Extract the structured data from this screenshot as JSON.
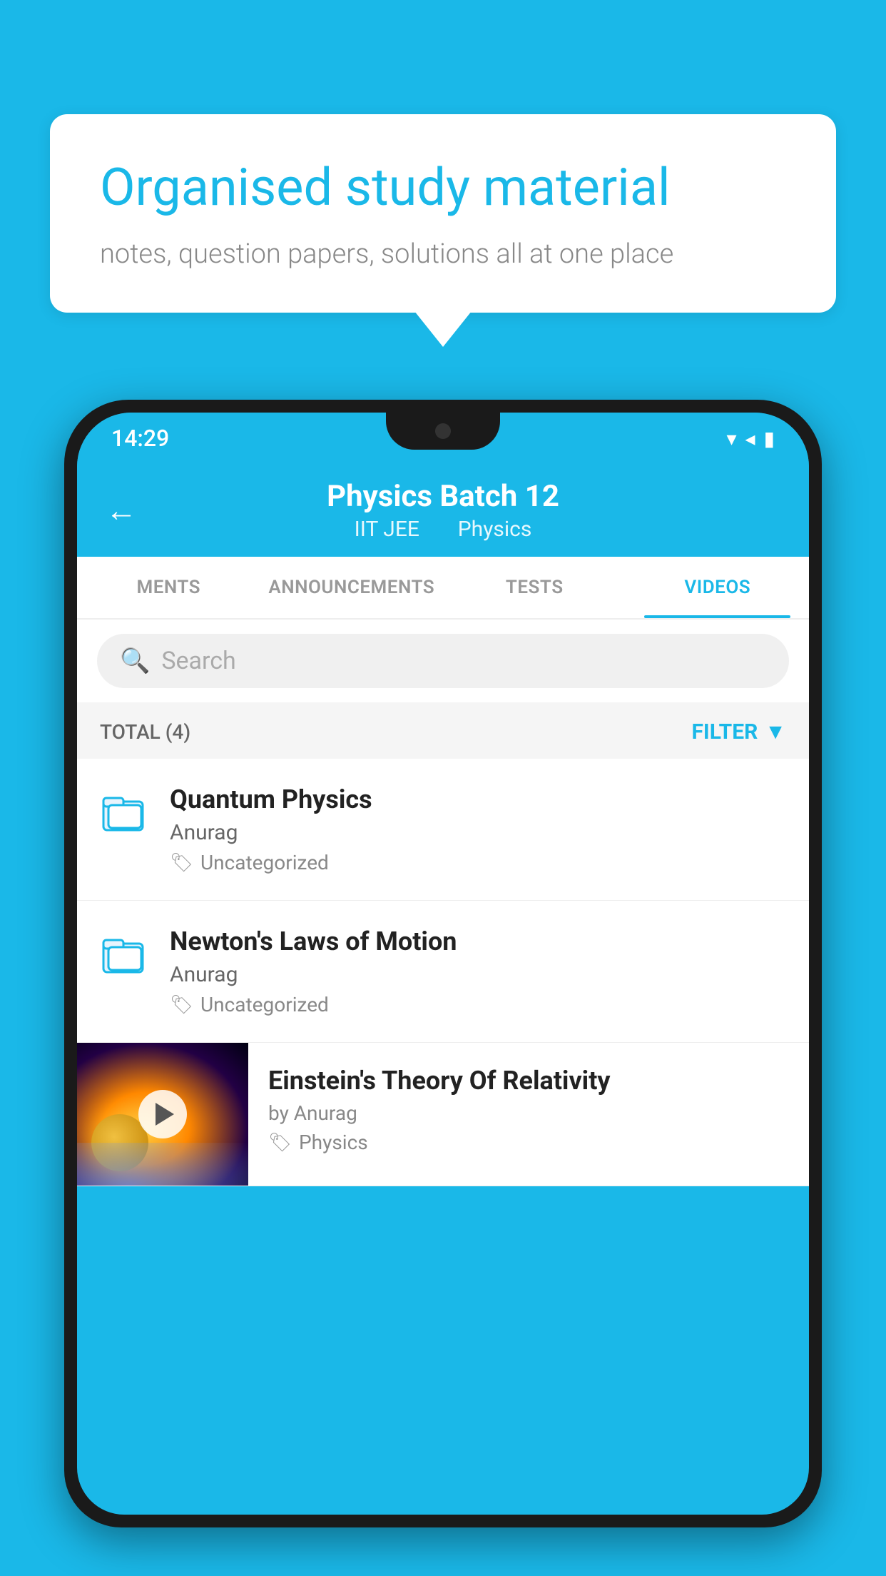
{
  "background": {
    "color": "#1ab8e8"
  },
  "speech_bubble": {
    "title": "Organised study material",
    "subtitle": "notes, question papers, solutions all at one place"
  },
  "status_bar": {
    "time": "14:29",
    "wifi": "▼",
    "signal": "▲",
    "battery": "▮"
  },
  "app_bar": {
    "back_label": "←",
    "title": "Physics Batch 12",
    "subtitle_board": "IIT JEE",
    "subtitle_subject": "Physics"
  },
  "tabs": [
    {
      "label": "MENTS",
      "active": false
    },
    {
      "label": "ANNOUNCEMENTS",
      "active": false
    },
    {
      "label": "TESTS",
      "active": false
    },
    {
      "label": "VIDEOS",
      "active": true
    }
  ],
  "search": {
    "placeholder": "Search"
  },
  "filter_bar": {
    "total_label": "TOTAL (4)",
    "filter_label": "FILTER"
  },
  "videos": [
    {
      "title": "Quantum Physics",
      "author": "Anurag",
      "tag": "Uncategorized",
      "has_thumb": false
    },
    {
      "title": "Newton's Laws of Motion",
      "author": "Anurag",
      "tag": "Uncategorized",
      "has_thumb": false
    },
    {
      "title": "Einstein's Theory Of Relativity",
      "author": "by Anurag",
      "tag": "Physics",
      "has_thumb": true
    }
  ]
}
